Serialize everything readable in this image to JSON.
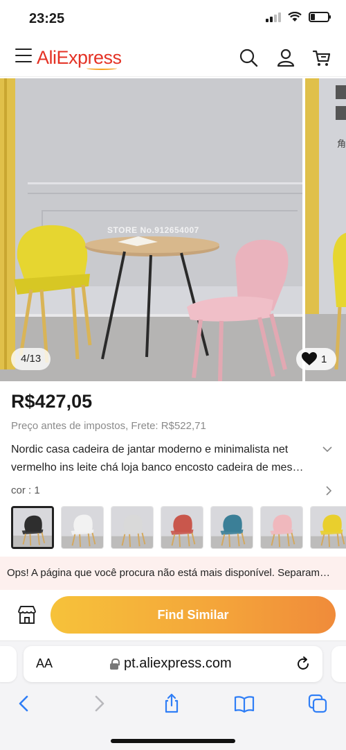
{
  "status_bar": {
    "time": "23:25"
  },
  "header": {
    "logo_text": "AliExpress",
    "icons": [
      "menu-icon",
      "search-icon",
      "account-icon",
      "cart-icon"
    ],
    "brand_color": "#e43225"
  },
  "gallery": {
    "counter": "4/13",
    "likes": "1",
    "watermark": "STORE No.912654007",
    "next_image_text": "角"
  },
  "product": {
    "price": "R$427,05",
    "subprice": "Preço antes de impostos, Frete: R$522,71",
    "title": "Nordic casa cadeira de jantar moderno e minimalista net vermelho ins leite chá loja banco encosto cadeira de mes…",
    "variant_label": "cor : 1",
    "swatches": [
      {
        "color": "#2e2e2e",
        "selected": true
      },
      {
        "color": "#f2f2f2",
        "selected": false
      },
      {
        "color": "#d9d9d9",
        "selected": false
      },
      {
        "color": "#c9574c",
        "selected": false
      },
      {
        "color": "#3b7f97",
        "selected": false
      },
      {
        "color": "#f0b8bd",
        "selected": false
      },
      {
        "color": "#e9cf2d",
        "selected": false
      }
    ]
  },
  "error_banner": {
    "text": "Ops! A página que você procura não está mais disponível. Separam…"
  },
  "actions": {
    "find_similar_label": "Find Similar",
    "button_colors": [
      "#f6c23a",
      "#f08b3a"
    ]
  },
  "browser": {
    "aa_label": "AA",
    "url": "pt.aliexpress.com"
  }
}
